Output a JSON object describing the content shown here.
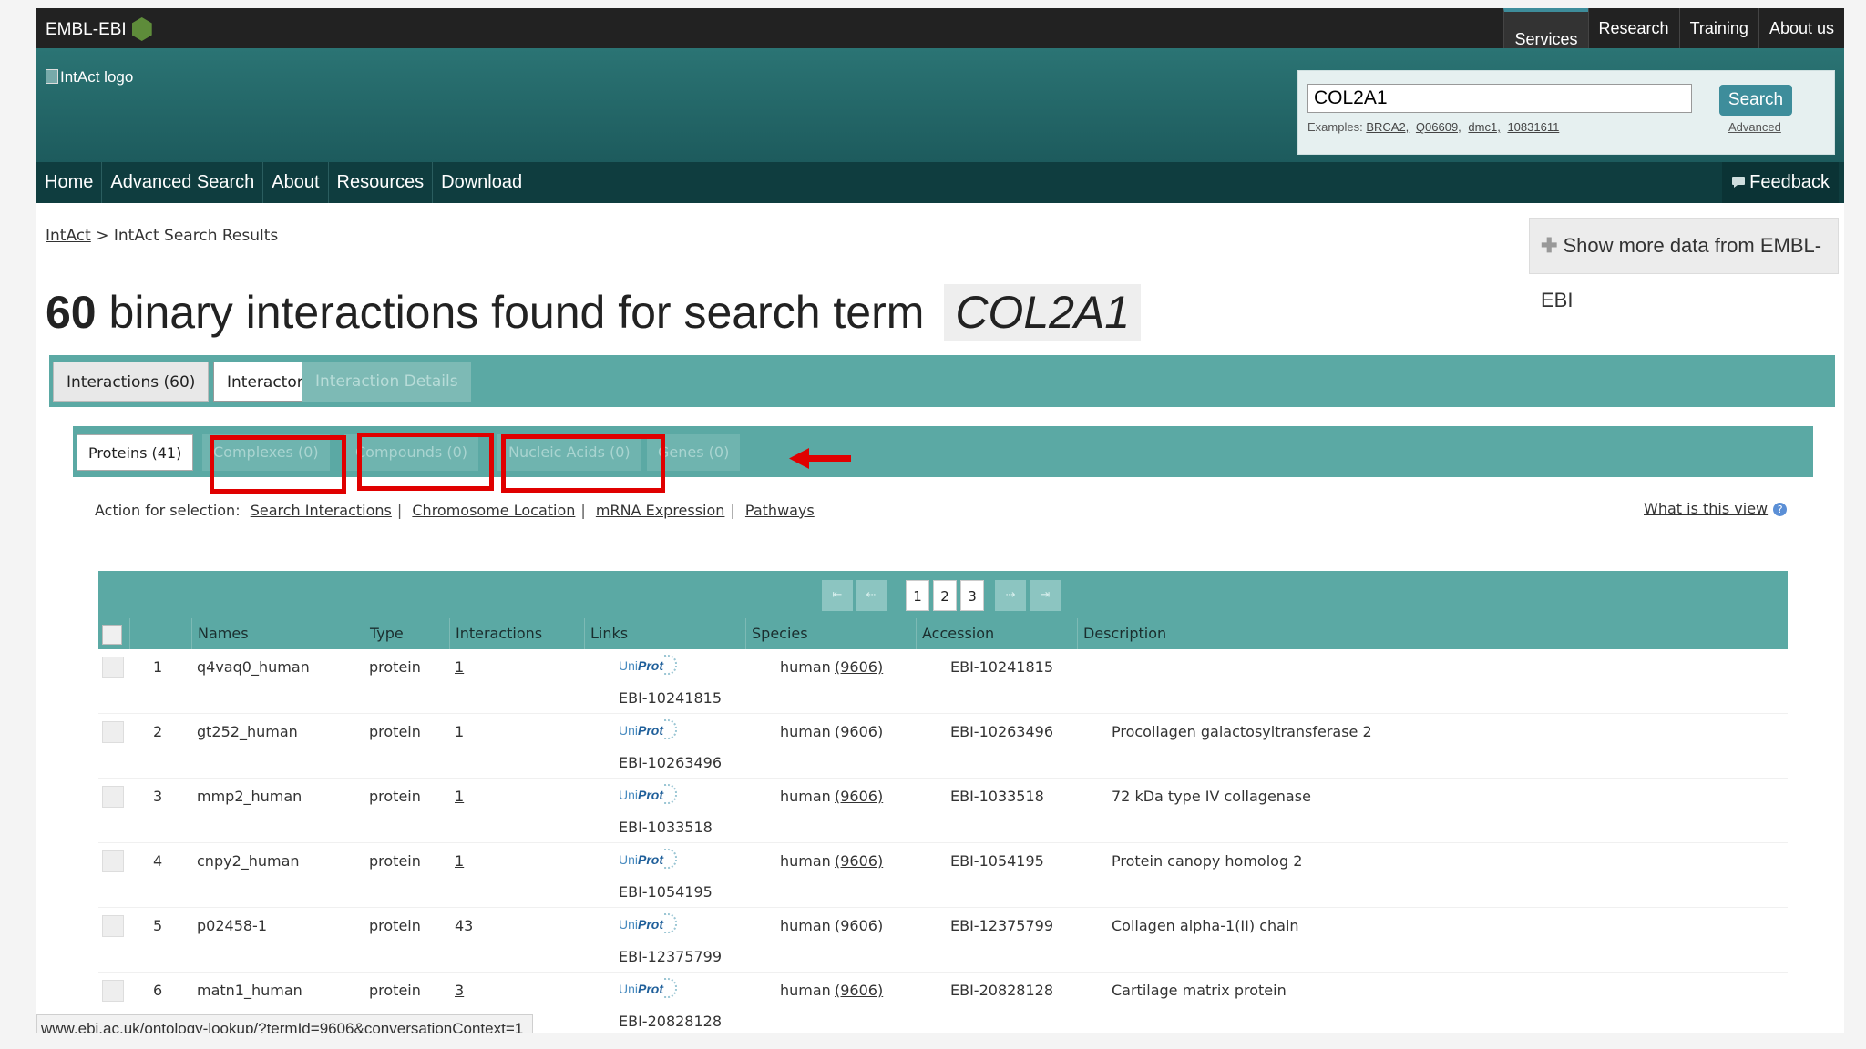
{
  "ebi_bar": {
    "logo_text": "EMBL-EBI",
    "nav": [
      "Services",
      "Research",
      "Training",
      "About us"
    ]
  },
  "masthead": {
    "logo_alt": "IntAct logo",
    "search_value": "COL2A1",
    "search_button": "Search",
    "examples_label": "Examples:",
    "examples": [
      "BRCA2,",
      "Q06609,",
      "dmc1,",
      "10831611"
    ],
    "advanced": "Advanced"
  },
  "local_nav": {
    "items": [
      "Home",
      "Advanced Search",
      "About",
      "Resources",
      "Download"
    ],
    "feedback": "Feedback"
  },
  "breadcrumb": {
    "root": "IntAct",
    "sep": ">",
    "current": "IntAct Search Results"
  },
  "show_more": "Show more data from EMBL-EBI",
  "heading": {
    "count": "60",
    "text": "binary interactions found for search term",
    "term": "COL2A1"
  },
  "outer_tabs": [
    "Interactions (60)",
    "Interactors",
    "Interaction Details"
  ],
  "inner_tabs": [
    "Proteins (41)",
    "Complexes (0)",
    "Compounds (0)",
    "Nucleic Acids (0)",
    "Genes (0)"
  ],
  "actions": {
    "label": "Action for selection:",
    "links": [
      "Search Interactions",
      "Chromosome Location",
      "mRNA Expression",
      "Pathways"
    ],
    "what_view": "What is this view",
    "help_icon_glyph": "?"
  },
  "pager": {
    "pages": [
      "1",
      "2",
      "3"
    ],
    "first": "⇤",
    "prev": "⇠",
    "next": "⇢",
    "last": "⇥"
  },
  "table": {
    "headers": [
      "Names",
      "Type",
      "Interactions",
      "Links",
      "Species",
      "Accession",
      "Description"
    ],
    "rows": [
      {
        "num": "1",
        "name": "q4vaq0_human",
        "type": "protein",
        "interactions": "1",
        "link_id": "EBI-10241815",
        "species": "human",
        "taxid": "(9606)",
        "accession": "EBI-10241815",
        "description": ""
      },
      {
        "num": "2",
        "name": "gt252_human",
        "type": "protein",
        "interactions": "1",
        "link_id": "EBI-10263496",
        "species": "human",
        "taxid": "(9606)",
        "accession": "EBI-10263496",
        "description": "Procollagen galactosyltransferase 2"
      },
      {
        "num": "3",
        "name": "mmp2_human",
        "type": "protein",
        "interactions": "1",
        "link_id": "EBI-1033518",
        "species": "human",
        "taxid": "(9606)",
        "accession": "EBI-1033518",
        "description": "72 kDa type IV collagenase"
      },
      {
        "num": "4",
        "name": "cnpy2_human",
        "type": "protein",
        "interactions": "1",
        "link_id": "EBI-1054195",
        "species": "human",
        "taxid": "(9606)",
        "accession": "EBI-1054195",
        "description": "Protein canopy homolog 2"
      },
      {
        "num": "5",
        "name": "p02458-1",
        "type": "protein",
        "interactions": "43",
        "link_id": "EBI-12375799",
        "species": "human",
        "taxid": "(9606)",
        "accession": "EBI-12375799",
        "description": "Collagen alpha-1(II) chain"
      },
      {
        "num": "6",
        "name": "matn1_human",
        "type": "protein",
        "interactions": "3",
        "link_id": "EBI-20828128",
        "species": "human",
        "taxid": "(9606)",
        "accession": "EBI-20828128",
        "description": "Cartilage matrix protein"
      }
    ],
    "uniprot_text_a": "Uni",
    "uniprot_text_b": "Prot"
  },
  "status_url": "www.ebi.ac.uk/ontology-lookup/?termId=9606&conversationContext=1",
  "colors": {
    "teal": "#5ba9a4",
    "dark_nav": "#0f3d3f",
    "highlight_red": "#e00000"
  },
  "icons": {
    "feedback": "speech-bubble-icon",
    "show_more": "plus-icon",
    "arrow": "red-arrow-left-icon"
  }
}
